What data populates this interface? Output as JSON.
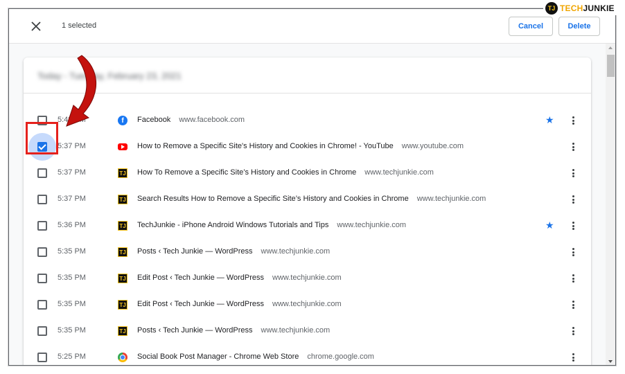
{
  "logo": {
    "text_part1": "TECH",
    "text_part2": "JUNKIE",
    "mark": "TJ"
  },
  "topbar": {
    "selected_text": "1 selected",
    "cancel_label": "Cancel",
    "delete_label": "Delete"
  },
  "card": {
    "header_blurred": "Today - Tuesday, February 23, 2021"
  },
  "rows": [
    {
      "time": "5:48 PM",
      "title": "Facebook",
      "domain": "www.facebook.com",
      "favicon": "facebook-icon",
      "checked": false,
      "starred": true
    },
    {
      "time": "5:37 PM",
      "title": "How to Remove a Specific Site's History and Cookies in Chrome! - YouTube",
      "domain": "www.youtube.com",
      "favicon": "youtube-icon",
      "checked": true,
      "starred": false
    },
    {
      "time": "5:37 PM",
      "title": "How To Remove a Specific Site’s History and Cookies in Chrome",
      "domain": "www.techjunkie.com",
      "favicon": "techjunkie-icon",
      "checked": false,
      "starred": false
    },
    {
      "time": "5:37 PM",
      "title": "Search Results How to Remove a Specific Site’s History and Cookies in Chrome",
      "domain": "www.techjunkie.com",
      "favicon": "techjunkie-icon",
      "checked": false,
      "starred": false
    },
    {
      "time": "5:36 PM",
      "title": "TechJunkie - iPhone Android Windows Tutorials and Tips",
      "domain": "www.techjunkie.com",
      "favicon": "techjunkie-icon",
      "checked": false,
      "starred": true
    },
    {
      "time": "5:35 PM",
      "title": "Posts ‹ Tech Junkie — WordPress",
      "domain": "www.techjunkie.com",
      "favicon": "techjunkie-icon",
      "checked": false,
      "starred": false
    },
    {
      "time": "5:35 PM",
      "title": "Edit Post ‹ Tech Junkie — WordPress",
      "domain": "www.techjunkie.com",
      "favicon": "techjunkie-icon",
      "checked": false,
      "starred": false
    },
    {
      "time": "5:35 PM",
      "title": "Edit Post ‹ Tech Junkie — WordPress",
      "domain": "www.techjunkie.com",
      "favicon": "techjunkie-icon",
      "checked": false,
      "starred": false
    },
    {
      "time": "5:35 PM",
      "title": "Posts ‹ Tech Junkie — WordPress",
      "domain": "www.techjunkie.com",
      "favicon": "techjunkie-icon",
      "checked": false,
      "starred": false
    },
    {
      "time": "5:25 PM",
      "title": "Social Book Post Manager - Chrome Web Store",
      "domain": "chrome.google.com",
      "favicon": "chrome-web-store-icon",
      "checked": false,
      "starred": false
    }
  ],
  "colors": {
    "accent": "#1a73e8",
    "annotation_red": "#e5211c"
  }
}
